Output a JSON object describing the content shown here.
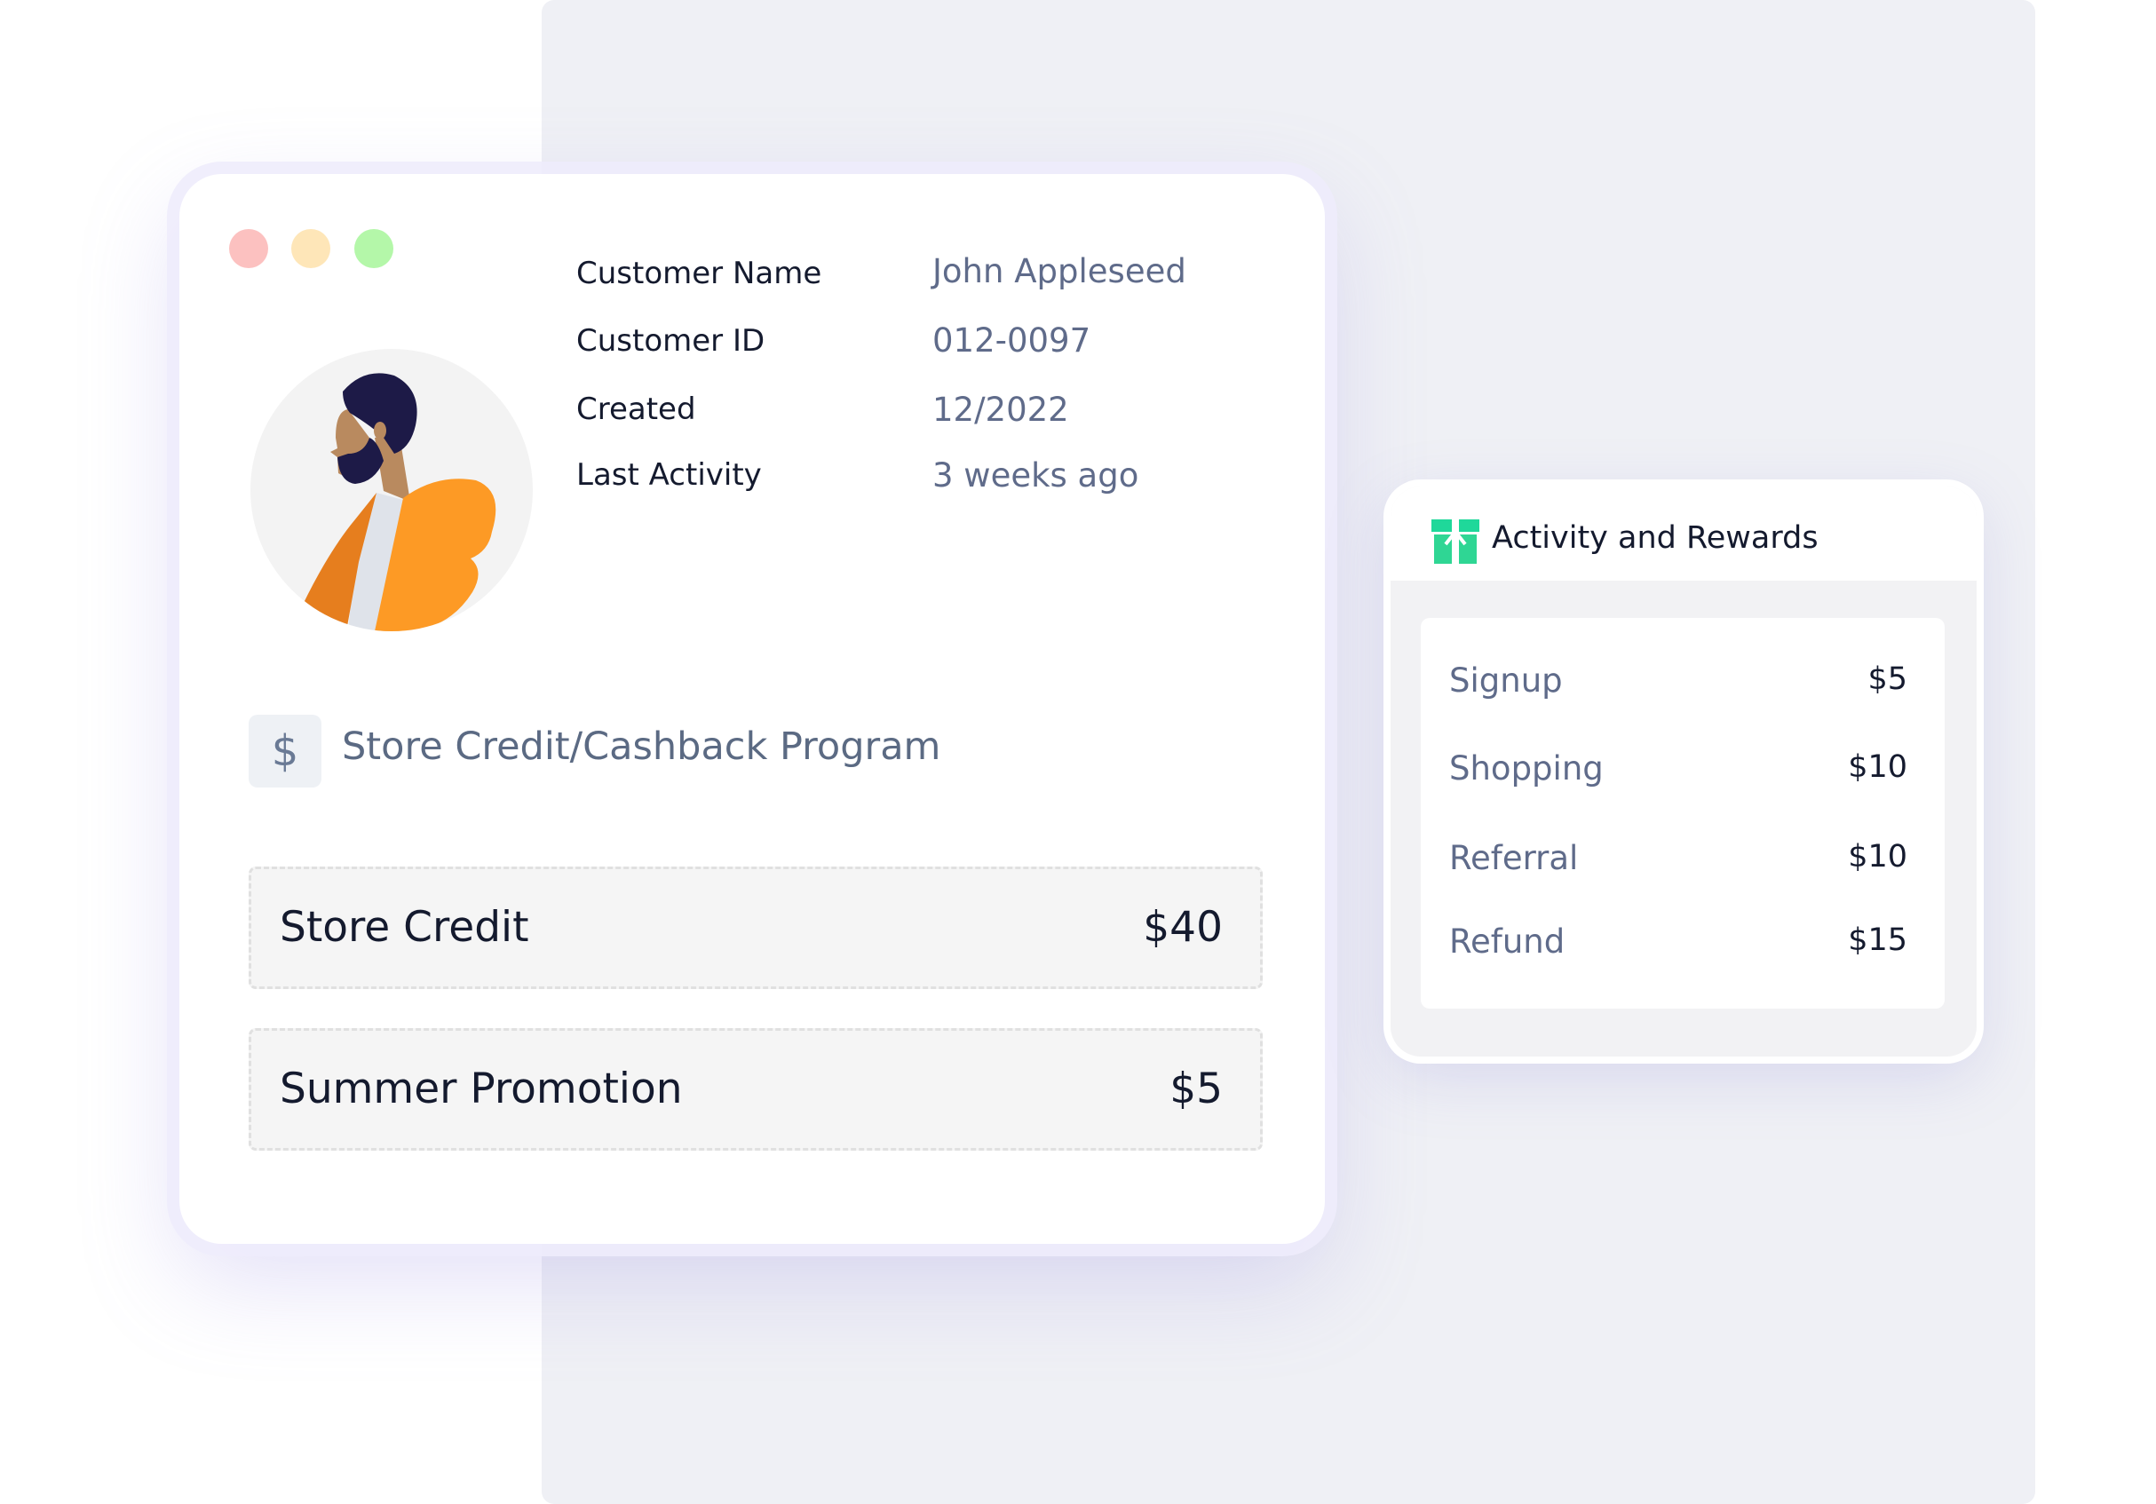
{
  "window": {
    "buttons": [
      {
        "name": "close",
        "color": "#fcc1c0"
      },
      {
        "name": "minimize",
        "color": "#fee6b8"
      },
      {
        "name": "zoom",
        "color": "#b4f7a9"
      }
    ]
  },
  "customer": {
    "fields": [
      {
        "label": "Customer Name",
        "value": "John Appleseed"
      },
      {
        "label": "Customer ID",
        "value": "012-0097"
      },
      {
        "label": "Created",
        "value": "12/2022"
      },
      {
        "label": "Last Activity",
        "value": "3 weeks ago"
      }
    ]
  },
  "program": {
    "icon": "dollar-icon",
    "icon_glyph": "$",
    "title": "Store Credit/Cashback Program"
  },
  "credits": [
    {
      "label": "Store Credit",
      "value": "$40"
    },
    {
      "label": "Summer Promotion",
      "value": "$5"
    }
  ],
  "rewards": {
    "icon": "gift-icon",
    "title": "Activity and Rewards",
    "items": [
      {
        "label": "Signup",
        "value": "$5"
      },
      {
        "label": "Shopping",
        "value": "$10"
      },
      {
        "label": "Referral",
        "value": "$10"
      },
      {
        "label": "Refund",
        "value": "$15"
      }
    ]
  },
  "colors": {
    "accent_green": "#2fd694",
    "avatar_orange": "#fd9a25",
    "label_text": "#141a2e",
    "muted_text": "#5f6b8a"
  }
}
